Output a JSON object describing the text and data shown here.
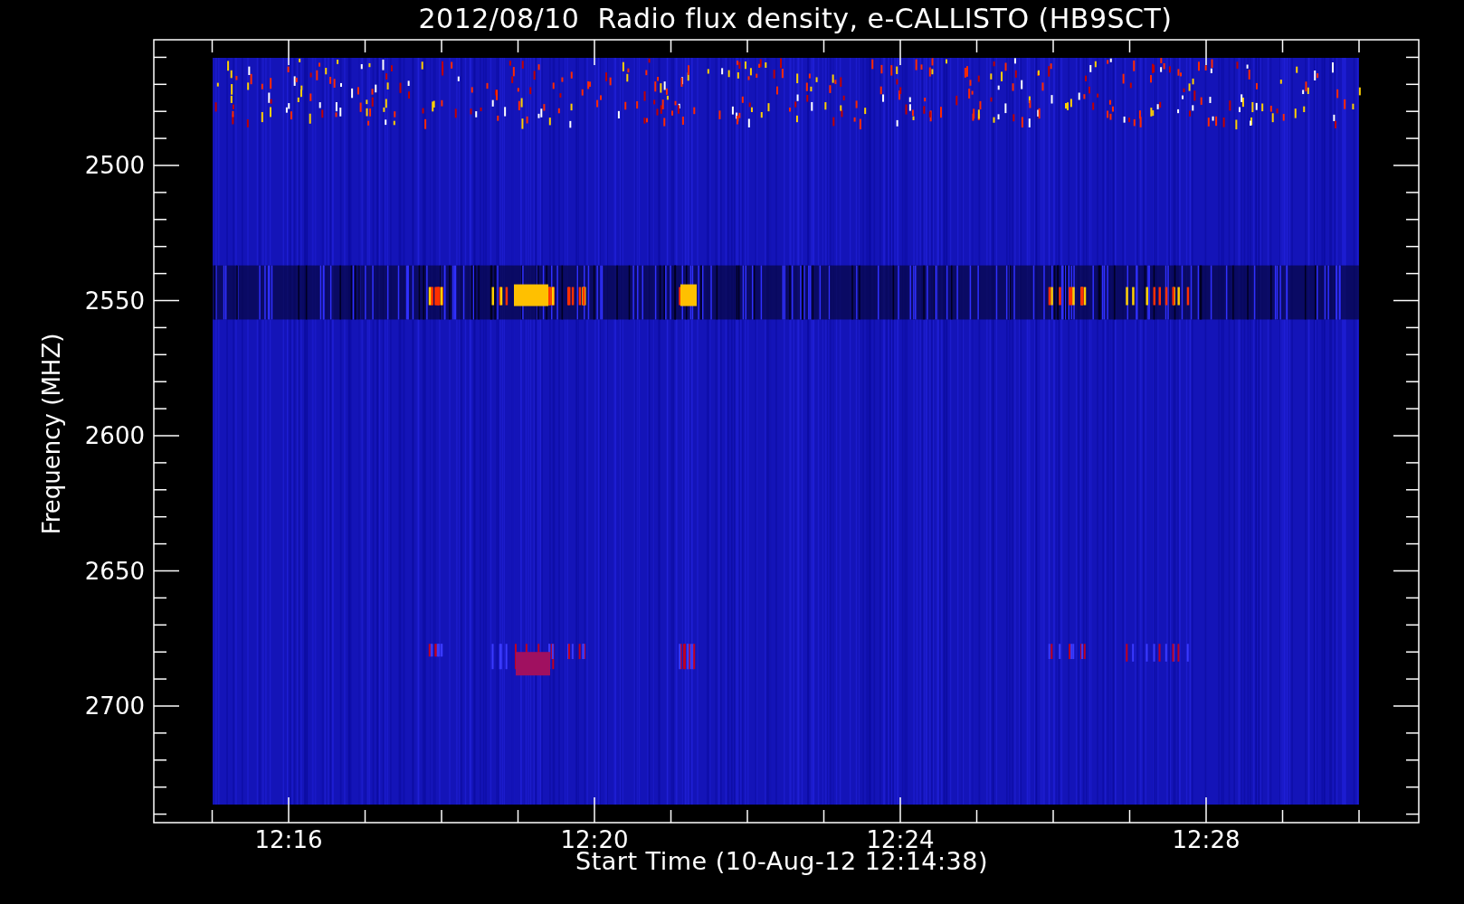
{
  "title": "2012/08/10  Radio flux density, e-CALLISTO (HB9SCT)",
  "y_axis": {
    "label": "Frequency (MHZ)",
    "ticks": [
      "2500",
      "2550",
      "2600",
      "2650",
      "2700"
    ]
  },
  "x_axis": {
    "label": "Start Time (10-Aug-12 12:14:38)",
    "ticks": [
      "12:16",
      "12:20",
      "12:24",
      "12:28"
    ]
  }
}
